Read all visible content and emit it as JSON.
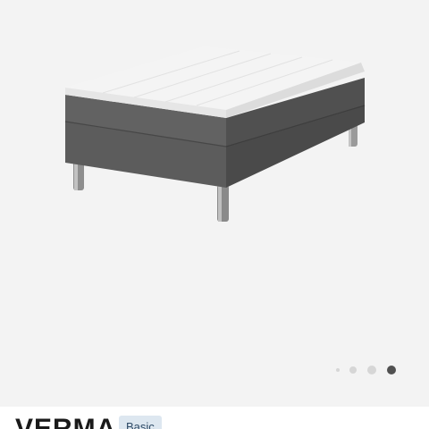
{
  "product": {
    "name": "VERMA",
    "badge": "Basic"
  },
  "gallery": {
    "image": "bed-icon",
    "image_count": 4,
    "active_index": 4
  },
  "colors": {
    "background": "#f3f3f3",
    "dot_active": "#505050",
    "dot_inactive": "#d6d6d6",
    "badge_bg": "#dde7f0"
  }
}
